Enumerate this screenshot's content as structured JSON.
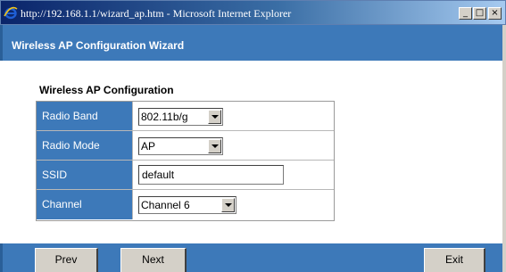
{
  "window": {
    "title": "http://192.168.1.1/wizard_ap.htm - Microsoft Internet Explorer",
    "minimize_glyph": "_",
    "maximize_glyph": "□",
    "close_glyph": "×"
  },
  "header": {
    "title": "Wireless AP Configuration Wizard"
  },
  "section": {
    "heading": "Wireless AP Configuration"
  },
  "form": {
    "radio_band": {
      "label": "Radio Band",
      "value": "802.11b/g"
    },
    "radio_mode": {
      "label": "Radio Mode",
      "value": "AP"
    },
    "ssid": {
      "label": "SSID",
      "value": "default"
    },
    "channel": {
      "label": "Channel",
      "value": "Channel 6"
    }
  },
  "footer": {
    "prev_label": "Prev",
    "next_label": "Next",
    "exit_label": "Exit"
  },
  "colors": {
    "accent_blue": "#3d79b9",
    "title_bar_start": "#0a246a",
    "button_face": "#d4d0c8"
  },
  "icons": {
    "browser": "ie-icon",
    "dropdown": "dropdown-arrow-icon"
  }
}
